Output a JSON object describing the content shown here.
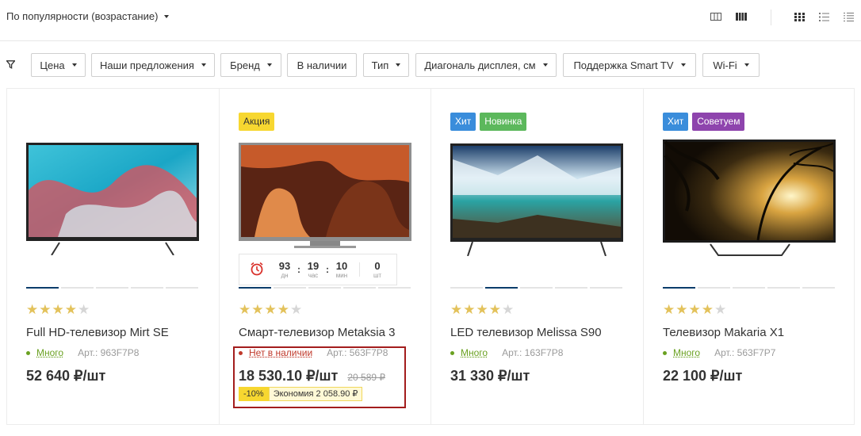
{
  "sort": {
    "label": "По популярности (возрастание)"
  },
  "filters": [
    "Цена",
    "Наши предложения",
    "Бренд",
    "В наличии",
    "Тип",
    "Диагональ дисплея, см",
    "Поддержка Smart TV",
    "Wi-Fi"
  ],
  "colors": {
    "accent": "#0b3d6b",
    "in_stock": "#6aa121",
    "out_stock": "#c0392b",
    "star": "#e3c25b",
    "badge_sale": "#f7d730",
    "badge_hit": "#3a8ddb",
    "badge_new": "#5cb85c",
    "badge_recommend": "#8e44ad",
    "highlight_border": "#a31d1d"
  },
  "products": [
    {
      "badges": [],
      "rating": 4,
      "title_prefix": "Full HD-телевизор",
      "title_name": "Mirt SE",
      "stock": "Много",
      "article": "Арт.: 963F7P8",
      "price": "52 640 ₽/шт"
    },
    {
      "badges": [
        {
          "label": "Акция",
          "type": "sale"
        }
      ],
      "rating": 4,
      "title_prefix": "Смарт-телевизор",
      "title_name": "Metaksia 3",
      "stock": "Нет в наличии",
      "article": "Арт.: 563F7P8",
      "price": "18 530.10 ₽/шт",
      "old_price": "20 589 ₽",
      "discount": "-10%",
      "economy": "Экономия 2 058.90 ₽",
      "timer": {
        "days": "93",
        "days_unit": "дн",
        "hours": "19",
        "hours_unit": "час",
        "minutes": "10",
        "minutes_unit": "мин",
        "qty": "0",
        "qty_unit": "шт"
      }
    },
    {
      "badges": [
        {
          "label": "Хит",
          "type": "hit"
        },
        {
          "label": "Новинка",
          "type": "new"
        }
      ],
      "rating": 4,
      "title_prefix": "LED телевизор",
      "title_name": "Melissa S90",
      "stock": "Много",
      "article": "Арт.: 163F7P8",
      "price": "31 330 ₽/шт"
    },
    {
      "badges": [
        {
          "label": "Хит",
          "type": "hit"
        },
        {
          "label": "Советуем",
          "type": "recommend"
        }
      ],
      "rating": 4,
      "title_prefix": "Телевизор",
      "title_name": "Makaria X1",
      "stock": "Много",
      "article": "Арт.: 563F7P7",
      "price": "22 100 ₽/шт"
    }
  ]
}
